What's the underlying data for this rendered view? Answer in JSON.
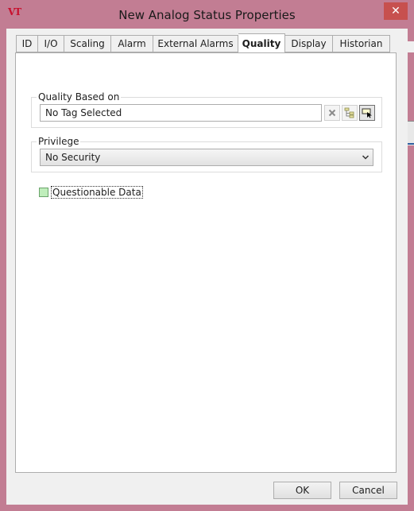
{
  "window": {
    "title": "New Analog Status Properties",
    "logo_text": "VT",
    "close_glyph": "✕"
  },
  "tabs": [
    {
      "label": "ID",
      "active": false
    },
    {
      "label": "I/O",
      "active": false
    },
    {
      "label": "Scaling",
      "active": false
    },
    {
      "label": "Alarm",
      "active": false
    },
    {
      "label": "External Alarms",
      "active": false
    },
    {
      "label": "Quality",
      "active": true
    },
    {
      "label": "Display",
      "active": false
    },
    {
      "label": "Historian",
      "active": false
    }
  ],
  "quality_based_on": {
    "label": "Quality Based on",
    "value": "No Tag Selected",
    "buttons": [
      "clear-icon",
      "tag-browser-icon",
      "select-tag-icon"
    ]
  },
  "privilege": {
    "label": "Privilege",
    "value": "No Security"
  },
  "questionable_data": {
    "label": "Questionable Data",
    "color": "#bfeebb"
  },
  "buttons": {
    "ok": "OK",
    "cancel": "Cancel"
  }
}
